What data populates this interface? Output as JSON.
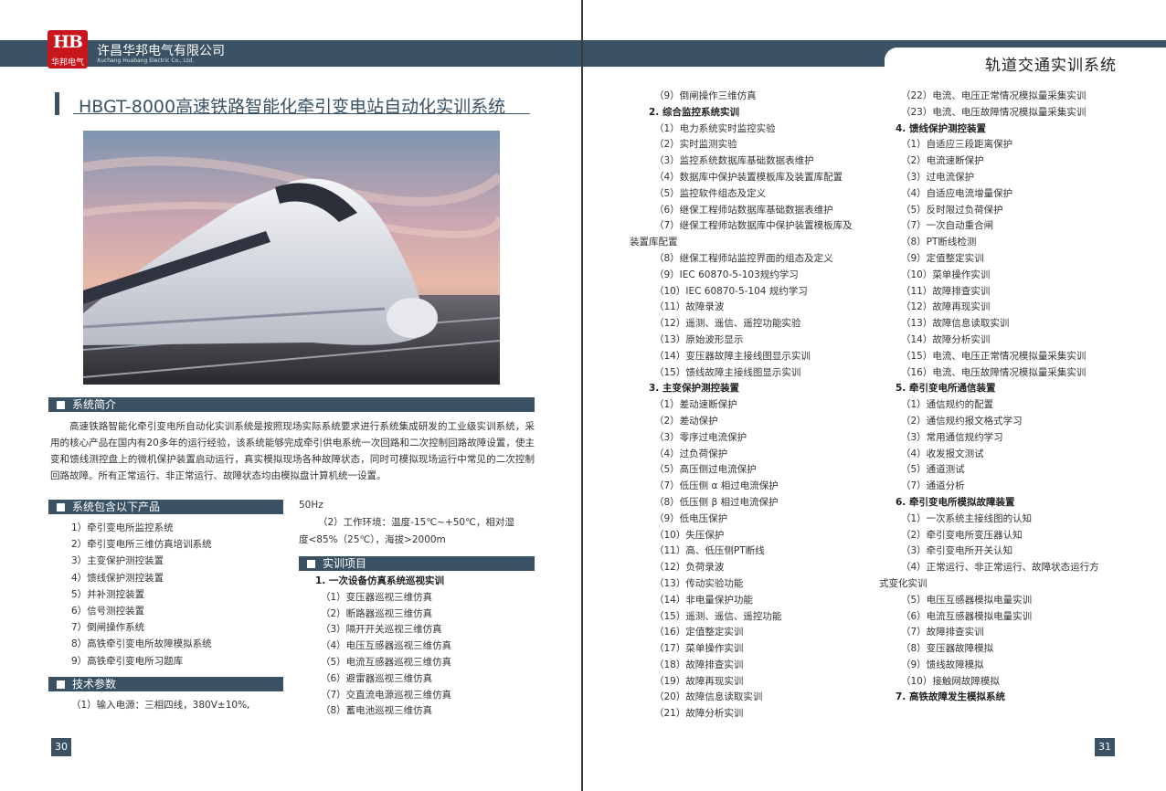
{
  "company": {
    "name_cn": "许昌华邦电气有限公司",
    "name_en": "Xuchang Huabang Electric Co., Ltd.",
    "logo_letters": "HB",
    "logo_sub": "华邦电气"
  },
  "header_right": "轨道交通实训系统",
  "title": "HBGT-8000高速铁路智能化牵引变电站自动化实训系统",
  "sections": {
    "intro": "系统简介",
    "products": "系统包含以下产品",
    "tech": "技术参数",
    "projects": "实训项目"
  },
  "intro_text": "高速铁路智能化牵引变电所自动化实训系统是按照现场实际系统要求进行系统集成研发的工业级实训系统，采用的核心产品在国内有20多年的运行经验，该系统能够完成牵引供电系统一次回路和二次控制回路故障设置，使主变和馈线测控盘上的微机保护装置启动运行，真实模拟现场各种故障状态，同时可模拟现场运行中常见的二次控制回路故障。所有正常运行、非正常运行、故障状态均由模拟盘计算机统一设置。",
  "products": [
    "1）牵引变电所监控系统",
    "2）牵引变电所三维仿真培训系统",
    "3）主变保护测控装置",
    "4）馈线保护测控装置",
    "5）并补测控装置",
    "6）信号测控装置",
    "7）倒闸操作系统",
    "8）高铁牵引变电所故障模拟系统",
    "9）高铁牵引变电所习题库"
  ],
  "tech_params": {
    "line1": "（1）输入电源：三相四线，380V±10%,",
    "line2": "50Hz",
    "line3": "（2）工作环境：温度-15℃~+50℃，相对湿",
    "line4": "度<85%（25℃），海拔>2000m"
  },
  "col1": [
    {
      "t": "1. 一次设备仿真系统巡视实训",
      "h": true
    },
    {
      "t": "（1）变压器巡视三维仿真"
    },
    {
      "t": "（2）断路器巡视三维仿真"
    },
    {
      "t": "（3）隔开开关巡视三维仿真"
    },
    {
      "t": "（4）电压互感器巡视三维仿真"
    },
    {
      "t": "（5）电流互感器巡视三维仿真"
    },
    {
      "t": "（6）避雷器巡视三维仿真"
    },
    {
      "t": "（7）交直流电源巡视三维仿真"
    },
    {
      "t": "（8）蓄电池巡视三维仿真"
    }
  ],
  "col2": [
    {
      "t": "（9）倒闸操作三维仿真"
    },
    {
      "t": "2. 综合监控系统实训",
      "h": true
    },
    {
      "t": "（1）电力系统实时监控实验"
    },
    {
      "t": "（2）实时监测实验"
    },
    {
      "t": "（3）监控系统数据库基础数据表维护"
    },
    {
      "t": "（4）数据库中保护装置模板库及装置库配置"
    },
    {
      "t": "（5）监控软件组态及定义"
    },
    {
      "t": "（6）继保工程师站数据库基础数据表维护"
    },
    {
      "t": "（7）继保工程师站数据库中保护装置模板库及"
    },
    {
      "t": "装置库配置",
      "o": true
    },
    {
      "t": "（8）继保工程师站监控界面的组态及定义"
    },
    {
      "t": "（9）IEC 60870-5-103规约学习"
    },
    {
      "t": "（10）IEC 60870-5-104 规约学习"
    },
    {
      "t": "（11）故障录波"
    },
    {
      "t": "（12）遥测、遥信、遥控功能实验"
    },
    {
      "t": "（13）原始波形显示"
    },
    {
      "t": "（14）变压器故障主接线图显示实训"
    },
    {
      "t": "（15）馈线故障主接线图显示实训"
    },
    {
      "t": "3. 主变保护测控装置",
      "h": true
    },
    {
      "t": "（1）差动速断保护"
    },
    {
      "t": "（2）差动保护"
    },
    {
      "t": "（3）零序过电流保护"
    },
    {
      "t": "（4）过负荷保护"
    },
    {
      "t": "（5）高压侧过电流保护"
    },
    {
      "t": "（7）低压侧 α 相过电流保护"
    },
    {
      "t": "（8）低压侧 β 相过电流保护"
    },
    {
      "t": "（9）低电压保护"
    },
    {
      "t": "（10）失压保护"
    },
    {
      "t": "（11）高、低压侧PT断线"
    },
    {
      "t": "（12）负荷录波"
    },
    {
      "t": "（13）传动实验功能"
    },
    {
      "t": "（14）非电量保护功能"
    },
    {
      "t": "（15）遥测、遥信、遥控功能"
    },
    {
      "t": "（16）定值整定实训"
    },
    {
      "t": "（17）菜单操作实训"
    },
    {
      "t": "（18）故障排查实训"
    },
    {
      "t": "（19）故障再现实训"
    },
    {
      "t": "（20）故障信息读取实训"
    },
    {
      "t": "（21）故障分析实训"
    }
  ],
  "col3": [
    {
      "t": "（22）电流、电压正常情况模拟量采集实训"
    },
    {
      "t": "（23）电流、电压故障情况模拟量采集实训"
    },
    {
      "t": "4. 馈线保护测控装置",
      "h": true
    },
    {
      "t": "（1）自适应三段距离保护"
    },
    {
      "t": "（2）电流速断保护"
    },
    {
      "t": "（3）过电流保护"
    },
    {
      "t": "（4）自适应电流增量保护"
    },
    {
      "t": "（5）反时限过负荷保护"
    },
    {
      "t": "（7）一次自动重合闸"
    },
    {
      "t": "（8）PT断线检测"
    },
    {
      "t": "（9）定值整定实训"
    },
    {
      "t": "（10）菜单操作实训"
    },
    {
      "t": "（11）故障排查实训"
    },
    {
      "t": "（12）故障再现实训"
    },
    {
      "t": "（13）故障信息读取实训"
    },
    {
      "t": "（14）故障分析实训"
    },
    {
      "t": "（15）电流、电压正常情况模拟量采集实训"
    },
    {
      "t": "（16）电流、电压故障情况模拟量采集实训"
    },
    {
      "t": "5. 牵引变电所通信装置",
      "h": true
    },
    {
      "t": "（1）通信规约的配置"
    },
    {
      "t": "（2）通信规约报文格式学习"
    },
    {
      "t": "（3）常用通信规约学习"
    },
    {
      "t": "（4）收发报文测试"
    },
    {
      "t": "（5）通道测试"
    },
    {
      "t": "（7）通道分析"
    },
    {
      "t": "6. 牵引变电所模拟故障装置",
      "h": true
    },
    {
      "t": "（1）一次系统主接线图的认知"
    },
    {
      "t": "（2）牵引变电所变压器认知"
    },
    {
      "t": "（3）牵引变电所开关认知"
    },
    {
      "t": "（4）正常运行、非正常运行、故障状态运行方"
    },
    {
      "t": "式变化实训",
      "o": true
    },
    {
      "t": "（5）电压互感器模拟电量实训"
    },
    {
      "t": "（6）电流互感器模拟电量实训"
    },
    {
      "t": "（7）故障排查实训"
    },
    {
      "t": "（8）变压器故障模拟"
    },
    {
      "t": "（9）馈线故障模拟"
    },
    {
      "t": "（10）接触网故障模拟"
    },
    {
      "t": "7. 高铁故障发生模拟系统",
      "h": true
    }
  ],
  "page_numbers": {
    "left": "30",
    "right": "31"
  },
  "colors": {
    "brand": "#3a5263",
    "logo_red": "#c8161d"
  }
}
